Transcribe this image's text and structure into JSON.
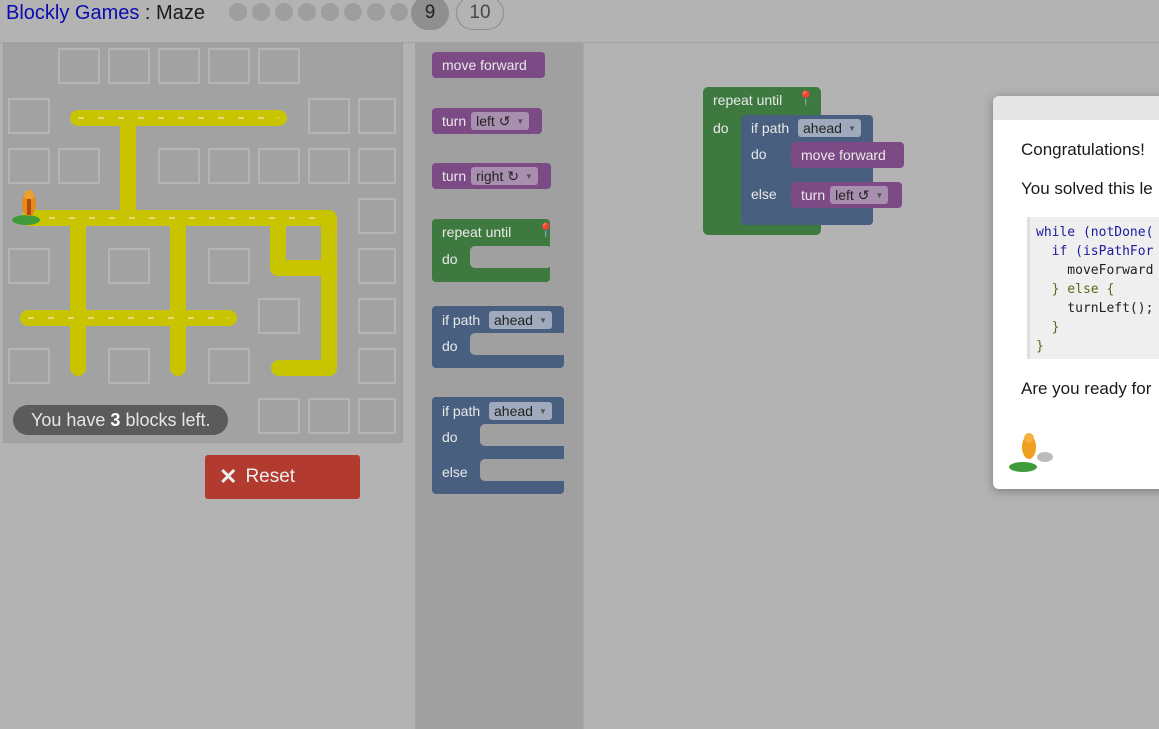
{
  "header": {
    "app_title": "Blockly Games",
    "separator": " : ",
    "game_title": "Maze",
    "level_dots_count": 8,
    "current_level": "9",
    "next_level": "10"
  },
  "maze": {
    "blocks_left_prefix": "You have ",
    "blocks_left_count": "3",
    "blocks_left_suffix": " blocks left.",
    "path_color": "#c8c400"
  },
  "reset_button": {
    "icon": "close-icon",
    "label": "Reset"
  },
  "toolbox": {
    "move_forward": "move forward",
    "turn_label": "turn",
    "turn_left_option": "left ↺",
    "turn_right_option": "right ↻",
    "repeat_until": "repeat until",
    "do_label": "do",
    "else_label": "else",
    "if_path": "if path",
    "ahead_option": "ahead"
  },
  "workspace": {
    "repeat_until": "repeat until",
    "do_label": "do",
    "if_path": "if path",
    "ahead_option": "ahead",
    "inner_do": "do",
    "move_forward": "move forward",
    "else_label": "else",
    "turn_label": "turn",
    "turn_left_option": "left ↺"
  },
  "dialog": {
    "congrats": "Congratulations!",
    "solved": "You solved this le",
    "code_lines": [
      "while (notDone(",
      "  if (isPathFor",
      "    moveForward",
      "  } else {",
      "    turnLeft();",
      "  }",
      "}"
    ],
    "ready": "Are you ready for"
  },
  "colors": {
    "motion_block": "#7c4a84",
    "loop_block": "#3e7a40",
    "logic_block": "#485f7f",
    "reset_button": "#b23a2e"
  }
}
